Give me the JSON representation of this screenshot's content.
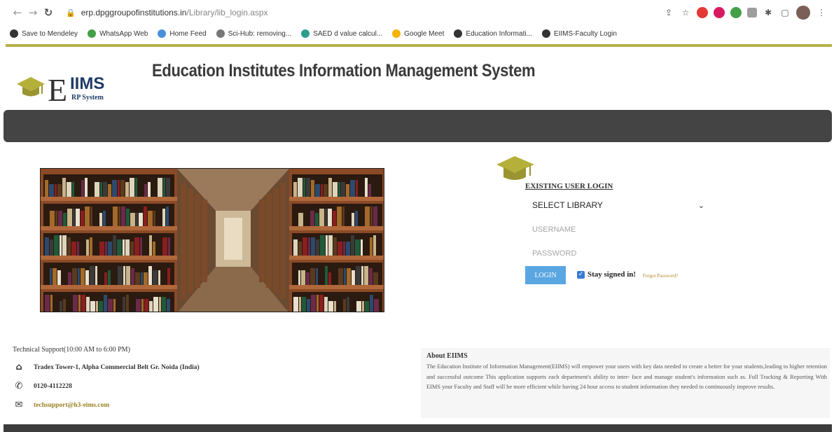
{
  "browser": {
    "url_host": "erp.dpggroupofinstitutions.in",
    "url_path": "/Library/lib_login.aspx",
    "bookmarks": [
      {
        "label": "Save to Mendeley",
        "color": "#333333"
      },
      {
        "label": "WhatsApp Web",
        "color": "#43a047"
      },
      {
        "label": "Home Feed",
        "color": "#4a90d9"
      },
      {
        "label": "Sci-Hub: removing...",
        "color": "#777777"
      },
      {
        "label": "SAED d value calcul...",
        "color": "#2e9e8f"
      },
      {
        "label": "Google Meet",
        "color": "#f4b400"
      },
      {
        "label": "Education Informati...",
        "color": "#333333"
      },
      {
        "label": "EIIMS-Faculty Login",
        "color": "#333333"
      }
    ]
  },
  "header": {
    "logo_letter": "E",
    "logo_ims": "IIMS",
    "logo_sub": "RP System",
    "title": "Education Institutes Information Management System"
  },
  "login": {
    "heading": "EXISTING USER LOGIN",
    "select_label": "SELECT LIBRARY",
    "username_placeholder": "USERNAME",
    "password_placeholder": "PASSWORD",
    "login_button": "LOGIN",
    "stay_signed_in": "Stay signed in!",
    "stay_checked": true,
    "forgot": "Forgot Password?"
  },
  "support": {
    "title": "Technical Support(10:00 AM to 6:00 PM)",
    "address": "Tradex Tower-1, Alpha Commercial Belt Gr. Noida (India)",
    "phone": "0120-4112228",
    "email": "techsupport@h3-eims.com"
  },
  "about": {
    "title": "About EIIMS",
    "text": "The Education Institute of Information Management(EIIMS) will empower your users with key data needed to create a better for your students,leading to higher retention and successful outcome This application supports each department's ability to inter- face and manage student's information such as. Full Tracking & Reporting With EIMS your Faculty and Staff will be more efficient while having 24 hour access to student information they needed to continuously improve results."
  },
  "colors": {
    "accent_yellow": "#b9b14a",
    "dark_bar": "#444444",
    "login_button": "#5aa6e2",
    "logo_navy": "#1f3c66",
    "cap_olive": "#b5b03a"
  }
}
